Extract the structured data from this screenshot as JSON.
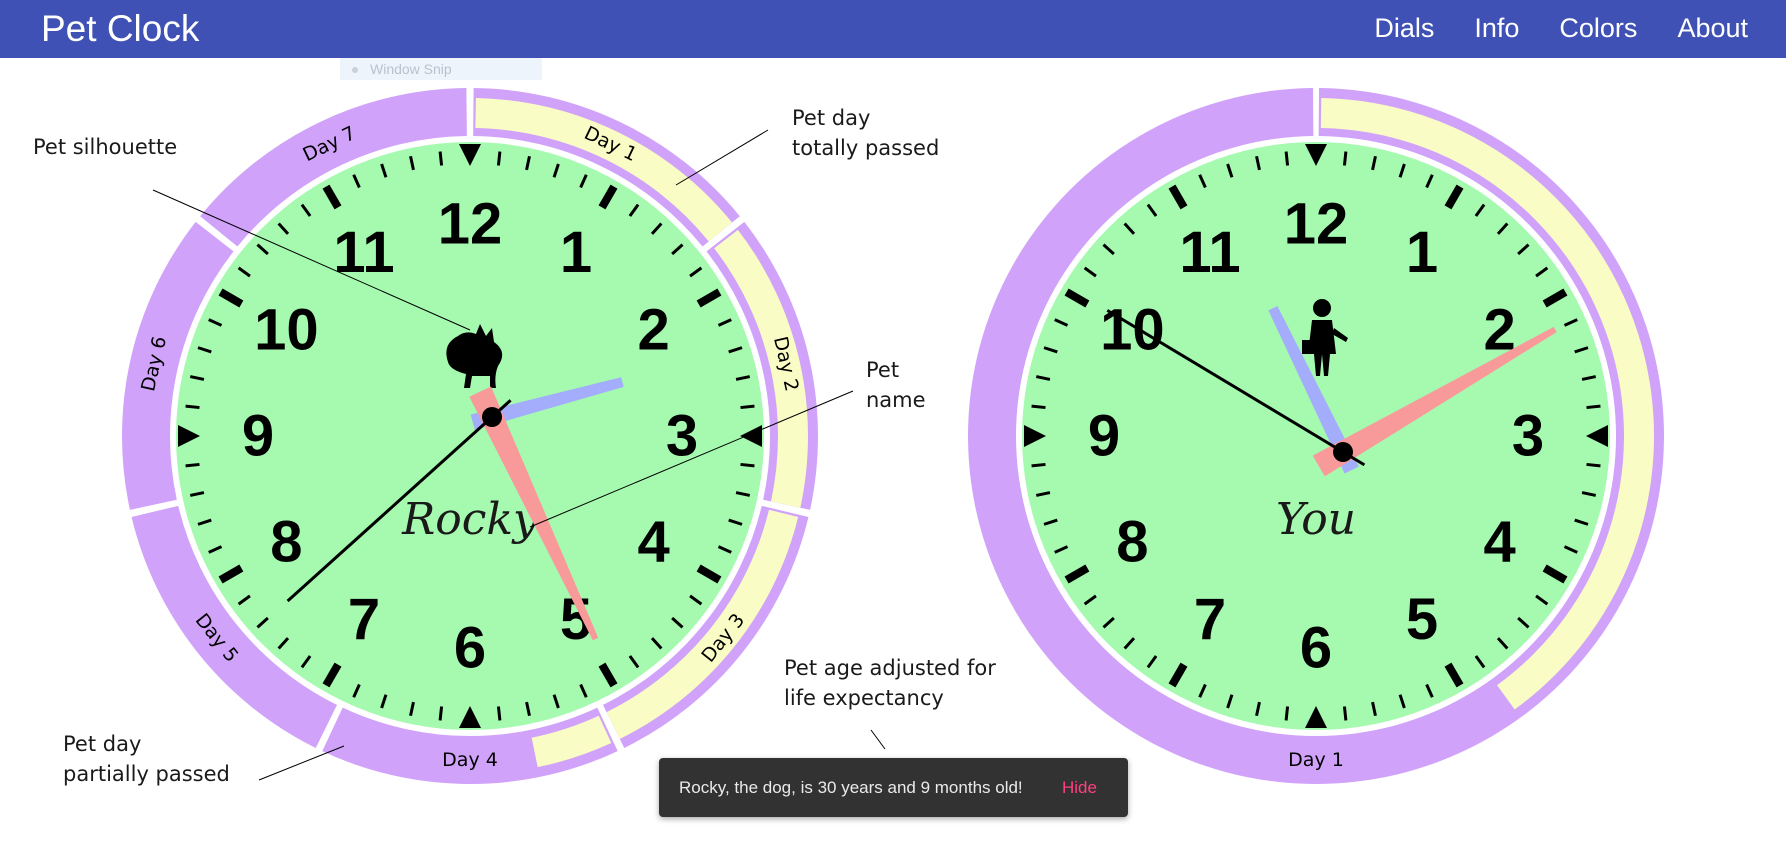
{
  "app": {
    "title": "Pet Clock"
  },
  "nav": [
    {
      "label": "Dials"
    },
    {
      "label": "Info"
    },
    {
      "label": "Colors"
    },
    {
      "label": "About"
    }
  ],
  "snip_overlay": {
    "label": "Window Snip"
  },
  "annotations": {
    "silhouette": "Pet silhouette",
    "day_passed": "Pet day\ntotally passed",
    "pet_name": "Pet\nname",
    "partial": "Pet day\npartially passed",
    "age_adjusted": "Pet age adjusted for\nlife expectancy"
  },
  "hour_numbers": [
    "12",
    "1",
    "2",
    "3",
    "4",
    "5",
    "6",
    "7",
    "8",
    "9",
    "10",
    "11"
  ],
  "colors": {
    "face": "#a5fab0",
    "ring_purple": "#d0a2fa",
    "ring_yellow": "#f9fcc4",
    "hour_hand": "#a3adfc",
    "minute_hand": "#f99a9a",
    "second_hand": "#000000",
    "accent": "#3f51b5",
    "toast_action": "#ff4081"
  },
  "clocks": [
    {
      "name": "Rocky",
      "silhouette": "dog-icon",
      "hands": {
        "hour_deg": 75,
        "minute_deg": 155,
        "second_deg": 228
      },
      "days": [
        {
          "label": "Day 1",
          "passed_fraction": 1
        },
        {
          "label": "Day 2",
          "passed_fraction": 1
        },
        {
          "label": "Day 3",
          "passed_fraction": 1
        },
        {
          "label": "Day 4",
          "passed_fraction": 0.27
        },
        {
          "label": "Day 5",
          "passed_fraction": 0
        },
        {
          "label": "Day 6",
          "passed_fraction": 0
        },
        {
          "label": "Day 7",
          "passed_fraction": 0
        }
      ]
    },
    {
      "name": "You",
      "silhouette": "person-icon",
      "hands": {
        "hour_deg": 334,
        "minute_deg": 60,
        "second_deg": 301
      },
      "days": [
        {
          "label": "Day 1",
          "passed_fraction": 0.4
        }
      ]
    }
  ],
  "toast": {
    "message": "Rocky, the dog, is 30 years and 9 months old!",
    "action": "Hide"
  }
}
